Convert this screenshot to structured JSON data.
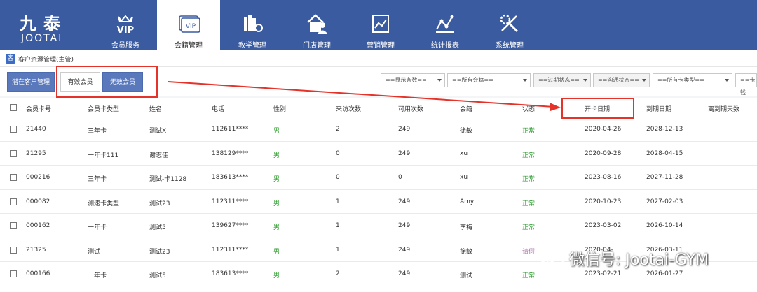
{
  "logo": {
    "cn": "九泰",
    "en": "JOOTAI"
  },
  "nav": [
    {
      "label": "会员服务",
      "icon": "vip-icon"
    },
    {
      "label": "会籍管理",
      "icon": "vip-card-icon"
    },
    {
      "label": "教学管理",
      "icon": "books-icon"
    },
    {
      "label": "门店管理",
      "icon": "store-icon"
    },
    {
      "label": "营销管理",
      "icon": "chart-icon"
    },
    {
      "label": "统计报表",
      "icon": "stats-icon"
    },
    {
      "label": "系统管理",
      "icon": "tools-icon"
    }
  ],
  "breadcrumb": "客户资源管理(主管)",
  "tabs": [
    "潜在客户管理",
    "有效会员",
    "无效会员"
  ],
  "filters": [
    "==显示条数==",
    "==所有会籍==",
    "==过期状态==",
    "==沟通状态==",
    "==所有卡类型==",
    "==卡钱"
  ],
  "columns": [
    "会员卡号",
    "会员卡类型",
    "姓名",
    "电话",
    "性别",
    "来访次数",
    "可用次数",
    "会籍",
    "状态",
    "开卡日期",
    "到期日期",
    "离到期天数"
  ],
  "rows": [
    [
      "21440",
      "三年卡",
      "测试X",
      "112611****",
      "男",
      "2",
      "249",
      "徐敏",
      "正常",
      "2020-04-26",
      "2028-12-13",
      ""
    ],
    [
      "21295",
      "一年卡111",
      "谢志佳",
      "138129****",
      "男",
      "0",
      "249",
      "xu",
      "正常",
      "2020-09-28",
      "2028-04-15",
      ""
    ],
    [
      "000216",
      "三年卡",
      "测试-卡1128",
      "183613****",
      "男",
      "0",
      "0",
      "xu",
      "正常",
      "2023-08-16",
      "2027-11-28",
      ""
    ],
    [
      "000082",
      "测速卡类型",
      "测试23",
      "112311****",
      "男",
      "1",
      "249",
      "Amy",
      "正常",
      "2020-10-23",
      "2027-02-03",
      ""
    ],
    [
      "000162",
      "一年卡",
      "测试5",
      "139627****",
      "男",
      "1",
      "249",
      "李梅",
      "正常",
      "2023-03-02",
      "2026-10-14",
      ""
    ],
    [
      "21325",
      "测试",
      "测试23",
      "112311****",
      "男",
      "1",
      "249",
      "徐敏",
      "请假",
      "2020-04-",
      "2026-03-11",
      ""
    ],
    [
      "000166",
      "一年卡",
      "测试5",
      "183613****",
      "男",
      "2",
      "249",
      "测试",
      "正常",
      "2023-02-21",
      "2026-01-27",
      ""
    ]
  ],
  "watermark": "微信号: Jootai-GYM",
  "colors": {
    "nav_bg": "#3a5ba0",
    "accent_red": "#e53329",
    "status_ok": "#2e9a2e"
  }
}
